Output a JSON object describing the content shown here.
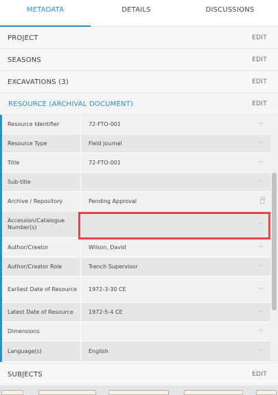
{
  "tabs": [
    {
      "label": "METADATA"
    },
    {
      "label": "DETAILS"
    },
    {
      "label": "DISCUSSIONS"
    }
  ],
  "sections": {
    "project": {
      "label": "PROJECT",
      "edit": "EDIT"
    },
    "seasons": {
      "label": "SEASONS",
      "edit": "EDIT"
    },
    "excavations": {
      "label": "EXCAVATIONS (3)",
      "edit": "EDIT"
    },
    "resource": {
      "label": "RESOURCE (ARCHIVAL DOCUMENT)",
      "edit": "EDIT"
    },
    "subjects": {
      "label": "SUBJECTS",
      "edit": "EDIT"
    }
  },
  "fields": [
    {
      "key": "Resource Identifier",
      "value": "72-FTO-001",
      "icon": "pencil-icon"
    },
    {
      "key": "Resource Type",
      "value": "Field journal",
      "icon": "pencil-icon"
    },
    {
      "key": "Title",
      "value": "72-FTO-001",
      "icon": "pencil-icon"
    },
    {
      "key": "Sub-title",
      "value": "",
      "icon": "pencil-icon"
    },
    {
      "key": "Archive / Repository",
      "value": "Pending Approval",
      "icon": "lock-icon"
    },
    {
      "key": "Accession/Catalogue Number(s)",
      "value": "",
      "icon": "pencil-icon"
    },
    {
      "key": "Author/Creator",
      "value": "Wilson, David",
      "icon": "pencil-icon"
    },
    {
      "key": "Author/Creator Role",
      "value": "Trench Supervisor",
      "icon": "pencil-icon"
    },
    {
      "key": "Earliest Date of Resource",
      "value": "1972-3-30 CE",
      "icon": "pencil-icon"
    },
    {
      "key": "Latest Date of Resource",
      "value": "1972-5-4 CE",
      "icon": "pencil-icon"
    },
    {
      "key": "Dimensions",
      "value": "",
      "icon": "pencil-icon"
    },
    {
      "key": "Language(s)",
      "value": "English",
      "icon": "pencil-icon"
    }
  ],
  "colors": {
    "accent": "#2a8fc4",
    "highlight": "#e24646"
  }
}
